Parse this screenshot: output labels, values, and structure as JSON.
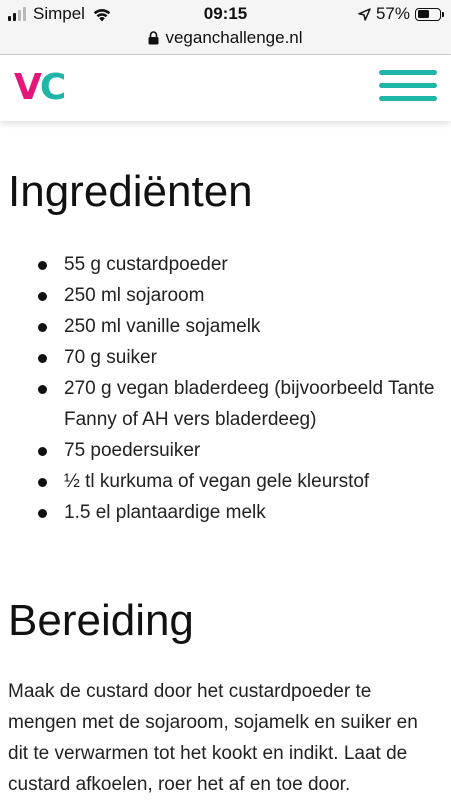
{
  "statusbar": {
    "carrier": "Simpel",
    "time": "09:15",
    "battery_text": "57%",
    "battery_level": 0.57,
    "signal_bars_filled": 2,
    "signal_bars_total": 4
  },
  "browser": {
    "url": "veganchallenge.nl"
  },
  "site": {
    "logo_v": "V",
    "logo_c": "C",
    "brand_colors": {
      "pink": "#e5157a",
      "teal": "#1fb5a8"
    }
  },
  "ingredients": {
    "heading": "Ingrediënten",
    "items": [
      "55 g custardpoeder",
      "250 ml sojaroom",
      "250 ml vanille sojamelk",
      "70 g suiker",
      "270 g vegan bladerdeeg (bijvoorbeeld Tante Fanny of AH vers bladerdeeg)",
      "75 poedersuiker",
      "½ tl kurkuma of vegan gele kleurstof",
      "1.5 el plantaardige melk"
    ]
  },
  "preparation": {
    "heading": "Bereiding",
    "paragraph": "Maak de custard door het custardpoeder te mengen met de sojaroom, sojamelk en suiker en dit te verwarmen tot het kookt en indikt. Laat de custard afkoelen, roer het af en toe door."
  },
  "icons": {
    "status": [
      "signal-icon",
      "wifi-icon",
      "location-icon",
      "battery-icon"
    ],
    "browser": [
      "lock-icon"
    ],
    "header": [
      "menu-icon"
    ]
  }
}
